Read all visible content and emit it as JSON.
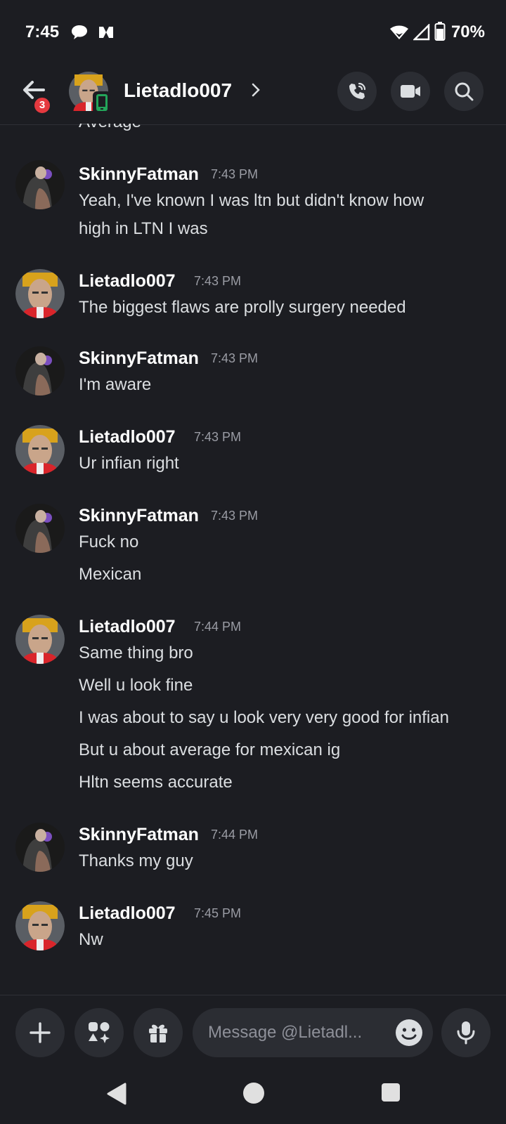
{
  "status_bar": {
    "time": "7:45",
    "battery": "70%",
    "icons": [
      "chat-bubble-icon",
      "app-icon",
      "wifi-icon",
      "signal-icon",
      "battery-icon"
    ]
  },
  "header": {
    "title": "Lietadlo007",
    "unread_badge": "3",
    "icons": [
      "back-arrow-icon",
      "chevron-right-icon",
      "call-icon",
      "video-icon",
      "search-icon"
    ]
  },
  "conversation": {
    "cutoff_text": "Average",
    "groups": [
      {
        "author": "SkinnyFatman",
        "time": "7:43 PM",
        "lines": [
          "Yeah, I've known I was ltn but didn't know how",
          "high in LTN I was"
        ]
      },
      {
        "author": "Lietadlo007",
        "time": "7:43 PM",
        "lines": [
          "The biggest flaws are prolly surgery needed"
        ]
      },
      {
        "author": "SkinnyFatman",
        "time": "7:43 PM",
        "lines": [
          "I'm aware"
        ]
      },
      {
        "author": "Lietadlo007",
        "time": "7:43 PM",
        "lines": [
          "Ur infian right"
        ]
      },
      {
        "author": "SkinnyFatman",
        "time": "7:43 PM",
        "lines": [
          "Fuck no",
          "Mexican"
        ]
      },
      {
        "author": "Lietadlo007",
        "time": "7:44 PM",
        "lines": [
          "Same thing bro",
          "Well u look fine",
          "I was about to say u look very very good for infian",
          "But u about average for mexican ig",
          "Hltn seems accurate"
        ]
      },
      {
        "author": "SkinnyFatman",
        "time": "7:44 PM",
        "lines": [
          "Thanks my guy"
        ]
      },
      {
        "author": "Lietadlo007",
        "time": "7:45 PM",
        "lines": [
          "Nw"
        ]
      }
    ]
  },
  "composer": {
    "placeholder": "Message @Lietadl...",
    "icons": [
      "plus-icon",
      "apps-icon",
      "gift-icon",
      "emoji-icon",
      "microphone-icon"
    ]
  },
  "nav_bar": {
    "icons": [
      "back-triangle-icon",
      "home-circle-icon",
      "recents-square-icon"
    ]
  },
  "colors": {
    "background": "#1c1d22",
    "button_bg": "#2b2d33",
    "badge": "#e5393f",
    "online_mobile": "#23a55a"
  }
}
